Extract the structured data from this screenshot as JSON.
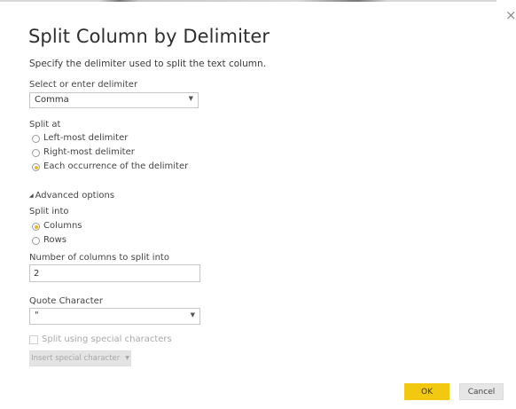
{
  "dialog": {
    "title": "Split Column by Delimiter",
    "description": "Specify the delimiter used to split the text column.",
    "close_glyph": "×"
  },
  "delimiter": {
    "label": "Select or enter delimiter",
    "value": "Comma"
  },
  "split_at": {
    "label": "Split at",
    "options": [
      {
        "label": "Left-most delimiter",
        "checked": false
      },
      {
        "label": "Right-most delimiter",
        "checked": false
      },
      {
        "label": "Each occurrence of the delimiter",
        "checked": true
      }
    ]
  },
  "advanced": {
    "label": "Advanced options"
  },
  "split_into": {
    "label": "Split into",
    "options": [
      {
        "label": "Columns",
        "checked": true
      },
      {
        "label": "Rows",
        "checked": false
      }
    ]
  },
  "num_columns": {
    "label": "Number of columns to split into",
    "value": "2"
  },
  "quote": {
    "label": "Quote Character",
    "value": "\""
  },
  "special": {
    "checkbox_label": "Split using special characters",
    "insert_label": "Insert special character"
  },
  "footer": {
    "ok_label": "OK",
    "cancel_label": "Cancel"
  },
  "colors": {
    "accent": "#f2c811",
    "radio_dot": "#e8b923"
  },
  "icons": {
    "dropdown": "chevron-down-icon",
    "advanced_toggle": "triangle-expand-icon",
    "close": "close-icon"
  }
}
